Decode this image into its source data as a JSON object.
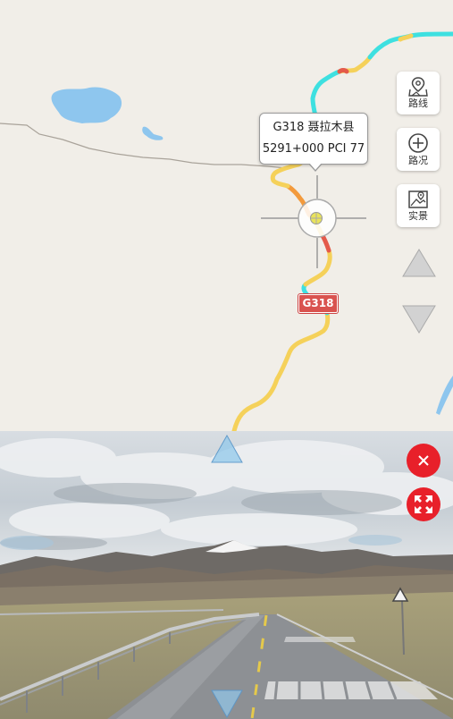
{
  "map": {
    "tooltip": {
      "line1": "G318 聂拉木县",
      "line2": "5291+000 PCI 77"
    },
    "route_badge": "G318",
    "side_buttons": [
      {
        "label": "路线",
        "icon": "map-pin-icon"
      },
      {
        "label": "路况",
        "icon": "plus-circle-icon"
      },
      {
        "label": "实景",
        "icon": "image-pin-icon"
      }
    ],
    "colors": {
      "background": "#f1eee8",
      "water": "#8ec6ee",
      "route_good": "#3ee0e0",
      "route_fair": "#f5d15a",
      "route_poor": "#f39a3c",
      "route_bad": "#e45a4a"
    }
  },
  "streetview": {
    "buttons": [
      {
        "name": "close",
        "icon": "close-icon"
      },
      {
        "name": "fullscreen",
        "icon": "expand-icon"
      }
    ],
    "accent": "#e8202a"
  }
}
